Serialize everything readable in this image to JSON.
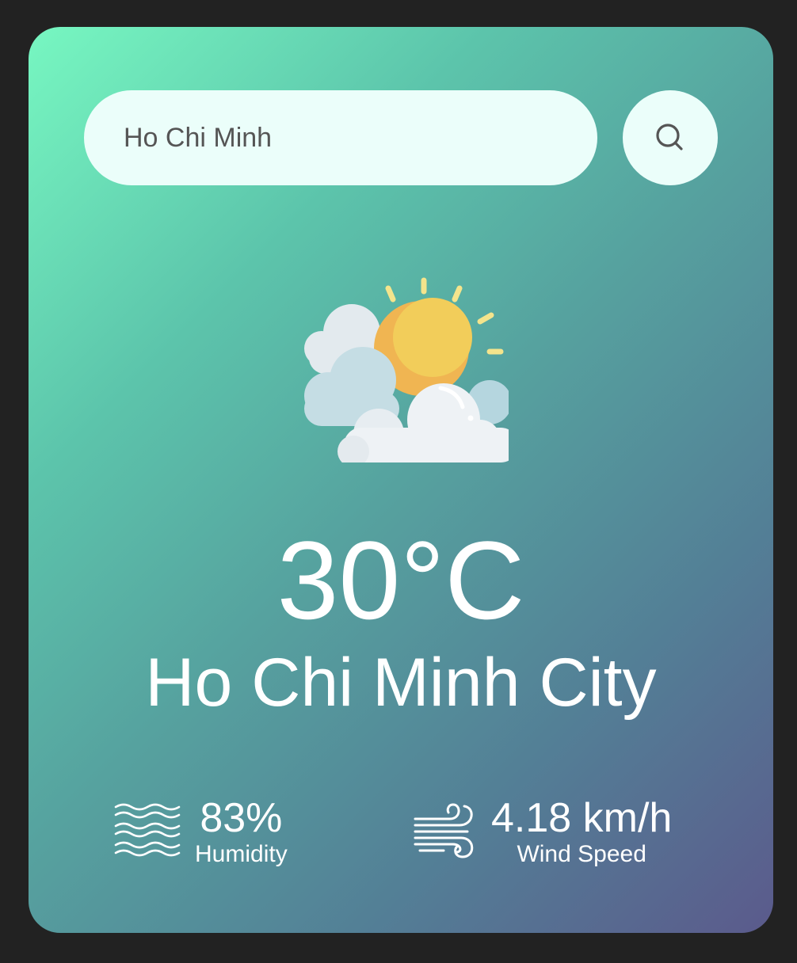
{
  "search": {
    "value": "Ho Chi Minh",
    "button_icon": "search-icon"
  },
  "weather": {
    "icon": "partly-cloudy-sun-icon",
    "temperature": "30°C",
    "city": "Ho Chi Minh City"
  },
  "stats": {
    "humidity": {
      "icon": "humidity-waves-icon",
      "value": "83%",
      "label": "Humidity"
    },
    "wind": {
      "icon": "wind-icon",
      "value": "4.18 km/h",
      "label": "Wind Speed"
    }
  },
  "colors": {
    "page_background": "#222222",
    "gradient_start": "#77f7c1",
    "gradient_end": "#5b5a8c",
    "input_background": "#ebfefa",
    "text": "#ffffff"
  }
}
